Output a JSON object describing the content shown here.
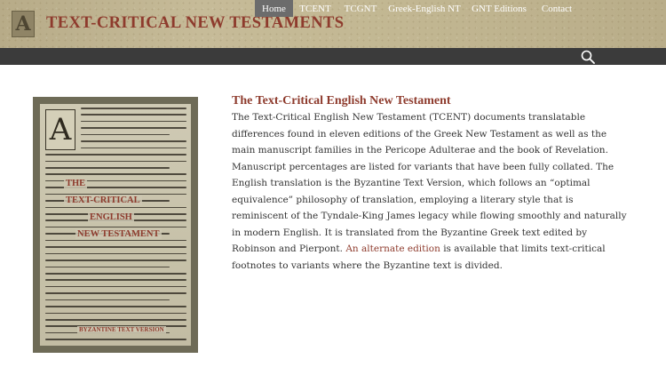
{
  "site": {
    "title": "TEXT-CRITICAL NEW TESTAMENTS",
    "logo_glyph": "A",
    "logo_icon": "illuminated-letter-logo"
  },
  "nav": {
    "items": [
      {
        "label": "Home",
        "active": true
      },
      {
        "label": "TCENT",
        "active": false
      },
      {
        "label": "TCGNT",
        "active": false
      },
      {
        "label": "Greek-English NT",
        "active": false
      },
      {
        "label": "GNT Editions",
        "active": false
      },
      {
        "label": "Contact",
        "active": false
      }
    ],
    "search_icon": "search-icon"
  },
  "image": {
    "initial": "A",
    "lines": [
      "THE",
      "TEXT-CRITICAL",
      "ENGLISH",
      "NEW TESTAMENT"
    ],
    "footer": "BYZANTINE TEXT VERSION"
  },
  "content": {
    "title": "The Text-Critical English New Testament",
    "body_before": "The Text-Critical English New Testament (TCENT) documents translatable differences found in eleven editions of the Greek New Testament as well as the main manuscript families in the Pericope Adulterae and the book of Revelation. Manuscript percentages are listed for variants that have been fully collated. The English translation is the Byzantine Text Version, which follows an “optimal equivalence” philosophy of translation, employing a literary style that is reminiscent of the Tyndale-King James legacy while flowing smoothly and naturally in modern English. It is translated from the Byzantine Greek text edited by Robinson and Pierpont.",
    "link_text": "An alternate edition",
    "body_after": "is available that limits text-critical footnotes to variants where the Byzantine text is divided."
  },
  "colors": {
    "accent": "#8e3b2d",
    "nav_bg": "#3b3b3b",
    "nav_active": "#6c6c6c",
    "header_bg": "#c2b792"
  }
}
